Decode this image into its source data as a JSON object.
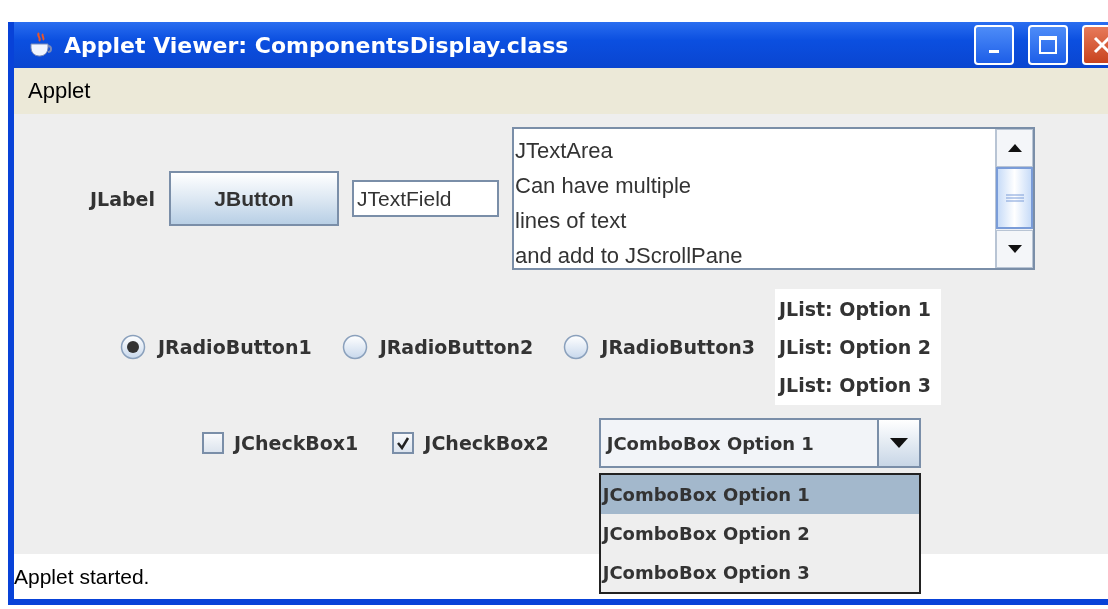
{
  "window": {
    "title": "Applet Viewer: ComponentsDisplay.class"
  },
  "menu_bar": [
    "Applet"
  ],
  "label": "JLabel",
  "button": "JButton",
  "text_field": {
    "value": "JTextField"
  },
  "text_area": {
    "lines": [
      "JTextArea",
      "Can have multiple",
      "lines of text",
      "and add to JScrollPane"
    ]
  },
  "radio_buttons": [
    {
      "label": "JRadioButton1",
      "selected": true
    },
    {
      "label": "JRadioButton2",
      "selected": false
    },
    {
      "label": "JRadioButton3",
      "selected": false
    }
  ],
  "list": [
    {
      "label": "JList: Option 1",
      "selected": false
    },
    {
      "label": "JList: Option 2",
      "selected": false
    },
    {
      "label": "JList: Option 3",
      "selected": false
    }
  ],
  "check_boxes": [
    {
      "label": "JCheckBox1",
      "checked": false
    },
    {
      "label": "JCheckBox2",
      "checked": true
    }
  ],
  "combo_box": {
    "value": "JComboBox Option 1",
    "expanded": true,
    "options": [
      {
        "label": "JComboBox Option 1",
        "selected": true
      },
      {
        "label": "JComboBox Option 2",
        "selected": false
      },
      {
        "label": "JComboBox Option 3",
        "selected": false
      }
    ]
  },
  "status_bar": "Applet started."
}
